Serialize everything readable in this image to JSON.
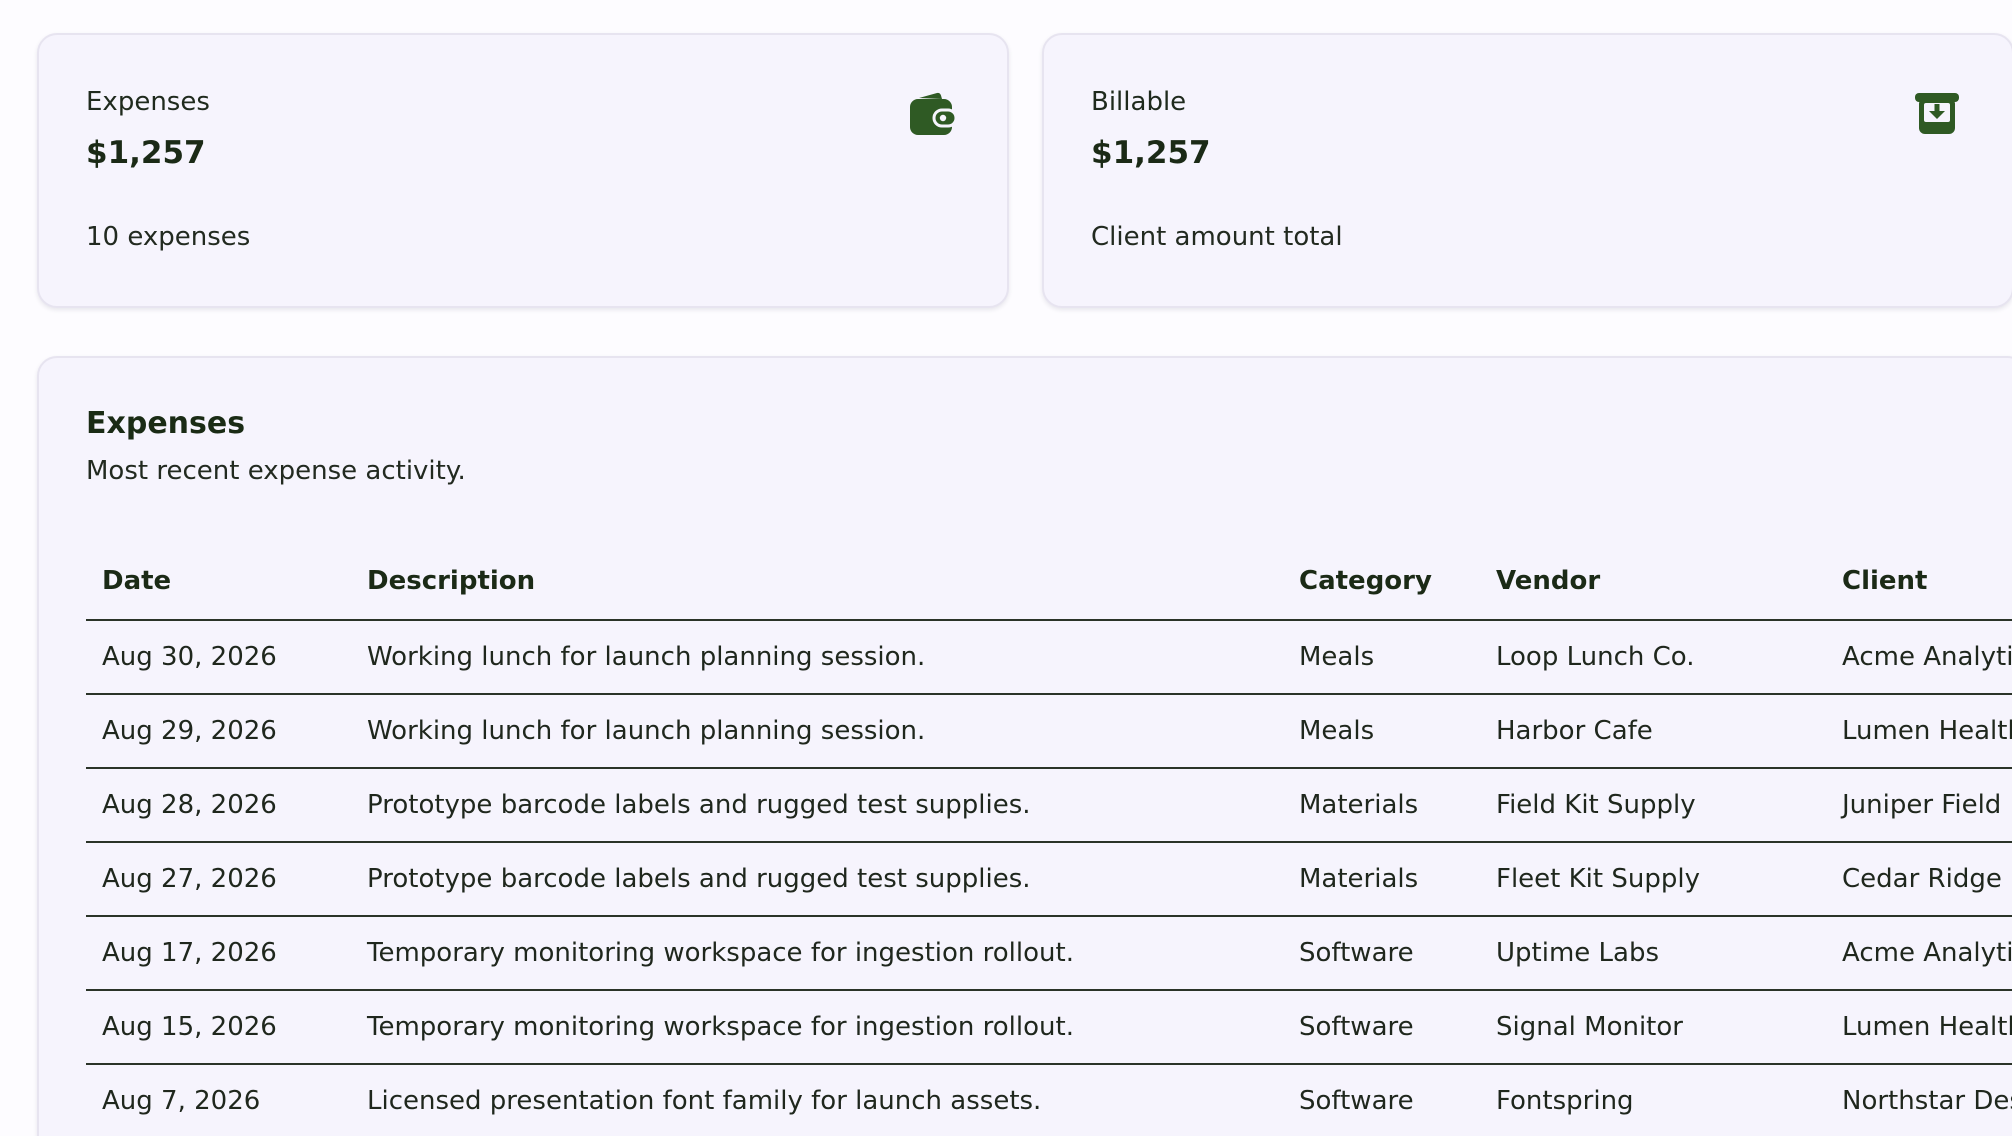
{
  "summary": {
    "expenses": {
      "label": "Expenses",
      "value": "$1,257",
      "subtext": "10 expenses",
      "icon": "wallet-icon"
    },
    "billable": {
      "label": "Billable",
      "value": "$1,257",
      "subtext": "Client amount total",
      "icon": "inbox-download-icon"
    }
  },
  "colors": {
    "accent": "#2f5a24",
    "card_background": "#f6f4fd",
    "row_border": "#2a3328"
  },
  "expenses_table": {
    "title": "Expenses",
    "subtitle": "Most recent expense activity.",
    "columns": [
      "Date",
      "Description",
      "Category",
      "Vendor",
      "Client"
    ],
    "rows": [
      {
        "date": "Aug 30, 2026",
        "description": "Working lunch for launch planning session.",
        "category": "Meals",
        "vendor": "Loop Lunch Co.",
        "client": "Acme Analyti"
      },
      {
        "date": "Aug 29, 2026",
        "description": "Working lunch for launch planning session.",
        "category": "Meals",
        "vendor": "Harbor Cafe",
        "client": "Lumen Health"
      },
      {
        "date": "Aug 28, 2026",
        "description": "Prototype barcode labels and rugged test supplies.",
        "category": "Materials",
        "vendor": "Field Kit Supply",
        "client": "Juniper Field"
      },
      {
        "date": "Aug 27, 2026",
        "description": "Prototype barcode labels and rugged test supplies.",
        "category": "Materials",
        "vendor": "Fleet Kit Supply",
        "client": "Cedar Ridge"
      },
      {
        "date": "Aug 17, 2026",
        "description": "Temporary monitoring workspace for ingestion rollout.",
        "category": "Software",
        "vendor": "Uptime Labs",
        "client": "Acme Analyti"
      },
      {
        "date": "Aug 15, 2026",
        "description": "Temporary monitoring workspace for ingestion rollout.",
        "category": "Software",
        "vendor": "Signal Monitor",
        "client": "Lumen Health"
      },
      {
        "date": "Aug 7, 2026",
        "description": "Licensed presentation font family for launch assets.",
        "category": "Software",
        "vendor": "Fontspring",
        "client": "Northstar Des"
      }
    ]
  }
}
